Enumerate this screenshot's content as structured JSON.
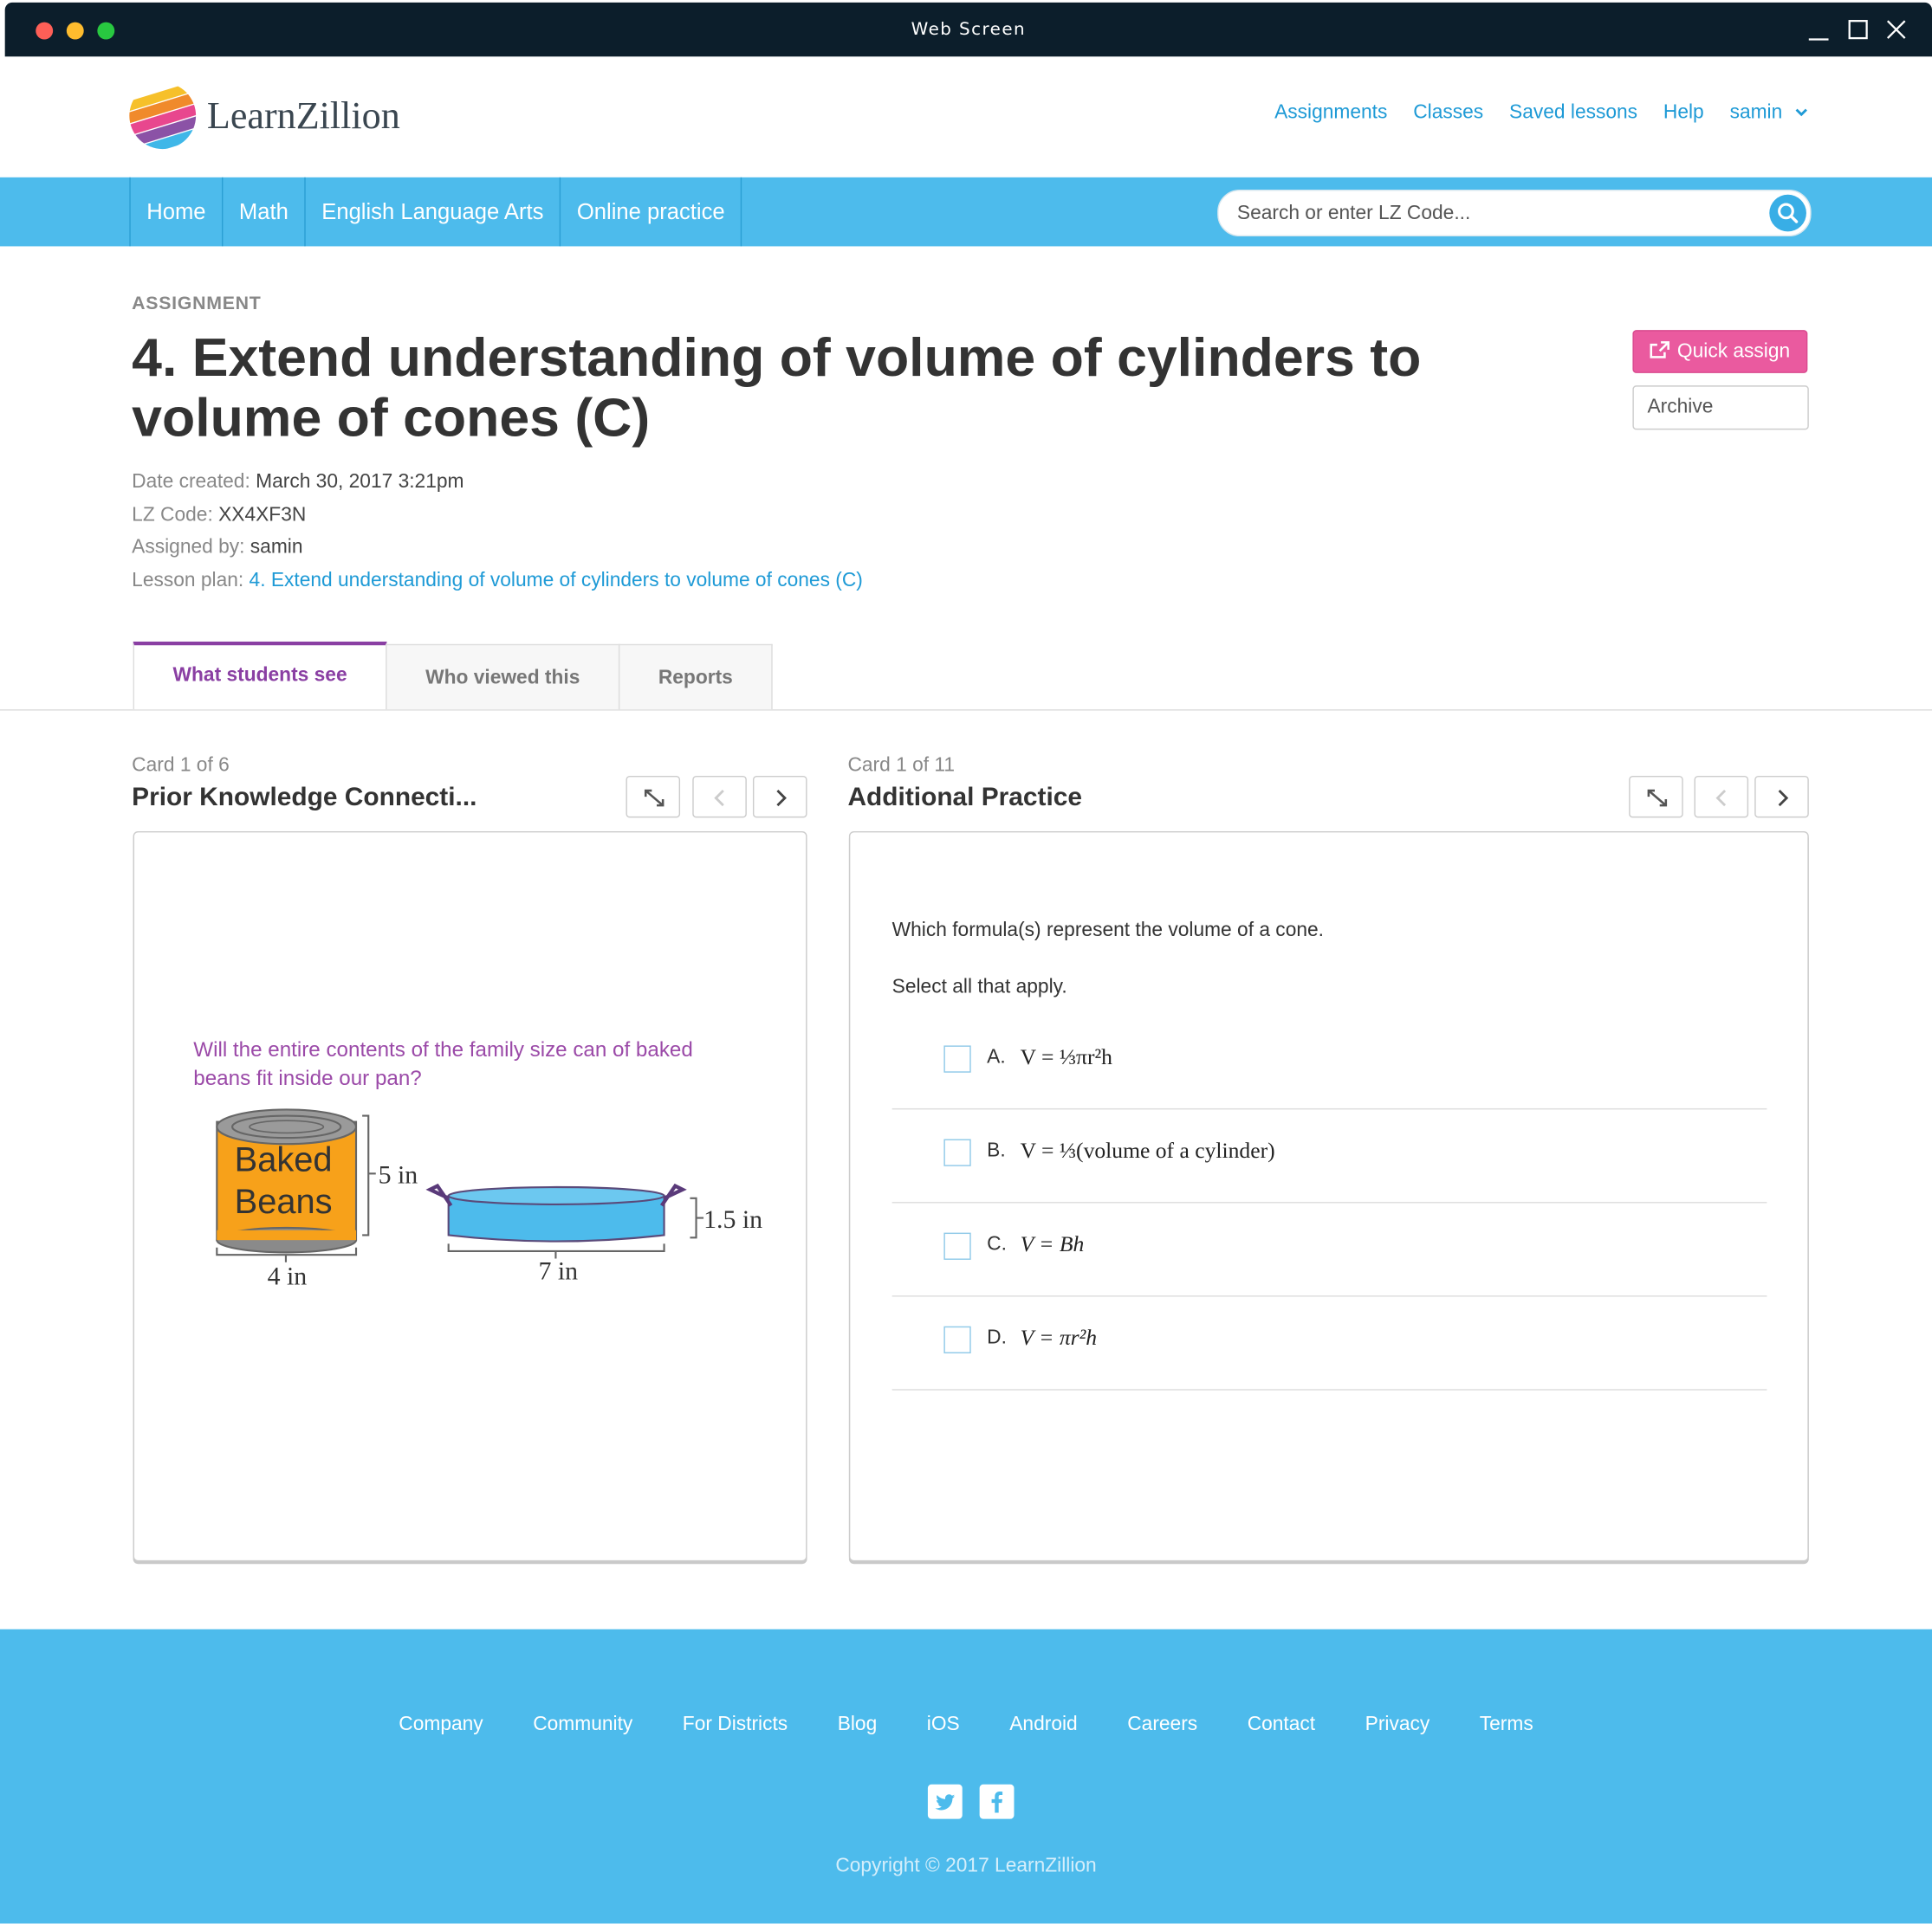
{
  "window": {
    "title": "Web Screen"
  },
  "brand": {
    "name": "LearnZillion"
  },
  "topnav": {
    "assignments": "Assignments",
    "classes": "Classes",
    "saved_lessons": "Saved lessons",
    "help": "Help",
    "user": "samin"
  },
  "mainnav": {
    "items": [
      "Home",
      "Math",
      "English Language Arts",
      "Online practice"
    ],
    "search_placeholder": "Search or enter LZ Code..."
  },
  "assignment": {
    "kicker": "ASSIGNMENT",
    "title": "4. Extend understanding of volume of cylinders to volume of cones (C)",
    "quick_assign": "Quick assign",
    "archive": "Archive",
    "date_label": "Date created:",
    "date_value": "March 30, 2017 3:21pm",
    "code_label": "LZ Code:",
    "code_value": "XX4XF3N",
    "assigned_label": "Assigned by:",
    "assigned_value": "samin",
    "lesson_label": "Lesson plan:",
    "lesson_value": "4. Extend understanding of volume of cylinders to volume of cones (C)"
  },
  "tabs": [
    "What students see",
    "Who viewed this",
    "Reports"
  ],
  "left_card": {
    "counter": "Card 1 of 6",
    "title": "Prior Knowledge Connecti...",
    "prompt": "Will the entire contents of the family size can of baked beans fit inside our pan?",
    "can_label_1": "Baked",
    "can_label_2": "Beans",
    "can_height": "5 in",
    "can_width": "4 in",
    "pan_height": "1.5 in",
    "pan_width": "7 in"
  },
  "right_card": {
    "counter": "Card 1 of 11",
    "title": "Additional Practice",
    "question": "Which formula(s) represent the volume of a cone.",
    "instruction": "Select all that apply.",
    "options": [
      {
        "letter": "A.",
        "formula": "V = ⅓πr²h"
      },
      {
        "letter": "B.",
        "formula": "V = ⅓(volume of a cylinder)"
      },
      {
        "letter": "C.",
        "formula": "V = Bh"
      },
      {
        "letter": "D.",
        "formula": "V = πr²h"
      }
    ]
  },
  "footer": {
    "links": [
      "Company",
      "Community",
      "For Districts",
      "Blog",
      "iOS",
      "Android",
      "Careers",
      "Contact",
      "Privacy",
      "Terms"
    ],
    "copyright": "Copyright © 2017 LearnZillion"
  },
  "colors": {
    "accent_blue": "#4dbbec",
    "link_blue": "#1e9ad6",
    "pink": "#ea5a9f",
    "purple": "#8a3fa3",
    "titlebar": "#0c1e2b"
  }
}
